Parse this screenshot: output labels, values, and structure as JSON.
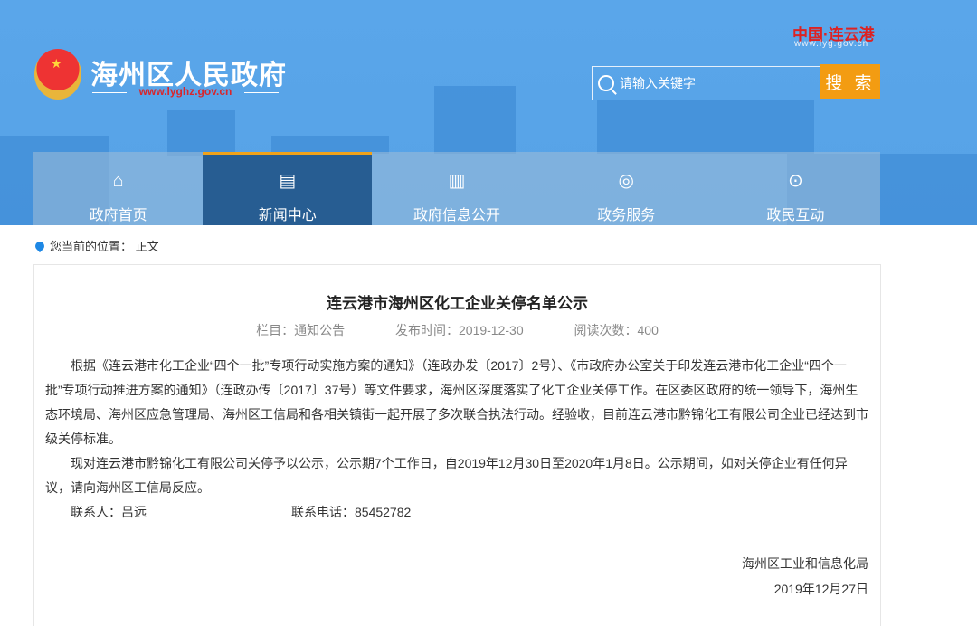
{
  "header": {
    "site_title": "海州区人民政府",
    "site_url": "www.lyghz.gov.cn",
    "partner_logo": "中国·连云港",
    "partner_url": "www.lyg.gov.cn",
    "search_placeholder": "请输入关键字",
    "search_button": "搜 索",
    "emblem_icon": "national-emblem"
  },
  "nav": [
    {
      "label": "政府首页",
      "icon": "home-icon"
    },
    {
      "label": "新闻中心",
      "icon": "news-icon"
    },
    {
      "label": "政府信息公开",
      "icon": "book-icon"
    },
    {
      "label": "政务服务",
      "icon": "shield-icon"
    },
    {
      "label": "政民互动",
      "icon": "chat-icon"
    }
  ],
  "breadcrumb": {
    "label": "您当前的位置：",
    "current": "正文"
  },
  "article": {
    "title": "连云港市海州区化工企业关停名单公示",
    "column": "栏目：通知公告",
    "published": "发布时间：2019-12-30",
    "views": "阅读次数：400",
    "paragraphs": [
      "根据《连云港市化工企业“四个一批”专项行动实施方案的通知》（连政办发〔2017〕2号）、《市政府办公室关于印发连云港市化工企业“四个一批”专项行动推进方案的通知》（连政办传〔2017〕37号）等文件要求，海州区深度落实了化工企业关停工作。在区委区政府的统一领导下，海州生态环境局、海州区应急管理局、海州区工信局和各相关镇街一起开展了多次联合执法行动。经验收，目前连云港市黔锦化工有限公司企业已经达到市级关停标准。",
      "现对连云港市黔锦化工有限公司关停予以公示，公示期7个工作日，自2019年12月30日至2020年1月8日。公示期间，如对关停企业有任何异议，请向海州区工信局反应。"
    ],
    "contact_person": "联系人：吕远",
    "contact_phone": "联系电话：85452782",
    "signature": "海州区工业和信息化局",
    "date": "2019年12月27日"
  }
}
